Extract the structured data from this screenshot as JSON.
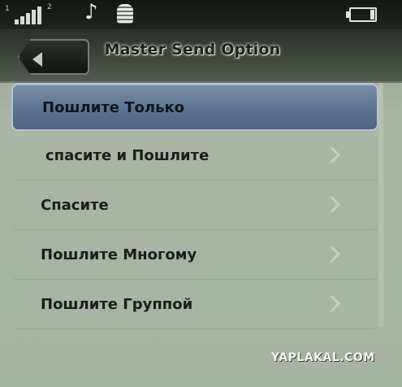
{
  "status": {
    "signal_sub": "1",
    "network_sub": "2",
    "music_icon": "music-note-icon",
    "lock_icon": "keypad-lock-icon",
    "battery_icon": "battery-icon"
  },
  "header": {
    "title": "Master Send Option",
    "back_icon": "back-arrow-icon"
  },
  "menu": {
    "items": [
      {
        "label": "Пошлите Только",
        "selected": true
      },
      {
        "label": "спасите и Пошлите",
        "selected": false
      },
      {
        "label": "Спасите",
        "selected": false
      },
      {
        "label": "Пошлите Многому",
        "selected": false
      },
      {
        "label": "Пошлите Группой",
        "selected": false
      }
    ]
  },
  "watermark": "YAPLAKAL.COM"
}
